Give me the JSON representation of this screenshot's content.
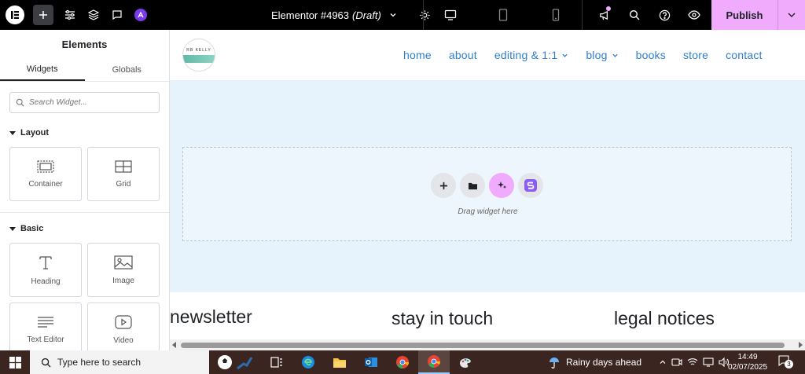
{
  "topbar": {
    "doc_title": "Elementor #4963",
    "doc_status": "(Draft)",
    "publish_label": "Publish",
    "publish_color": "#f0abfc"
  },
  "panel": {
    "title": "Elements",
    "tabs": [
      "Widgets",
      "Globals"
    ],
    "search_placeholder": "Search Widget...",
    "sections": [
      {
        "title": "Layout",
        "widgets": [
          "Container",
          "Grid"
        ]
      },
      {
        "title": "Basic",
        "widgets": [
          "Heading",
          "Image",
          "Text Editor",
          "Video"
        ]
      }
    ]
  },
  "canvas": {
    "logo_text": "RB KELLY",
    "nav": [
      "home",
      "about",
      "editing & 1:1",
      "blog",
      "books",
      "store",
      "contact"
    ],
    "nav_color": "#2f7fce",
    "dropzone_text": "Drag widget here",
    "footer_columns": [
      "newsletter",
      "stay in touch",
      "legal notices"
    ]
  },
  "taskbar": {
    "search_placeholder": "Type here to search",
    "weather": "Rainy days ahead",
    "time": "14:49",
    "date": "02/07/2025",
    "notifications": "3"
  }
}
